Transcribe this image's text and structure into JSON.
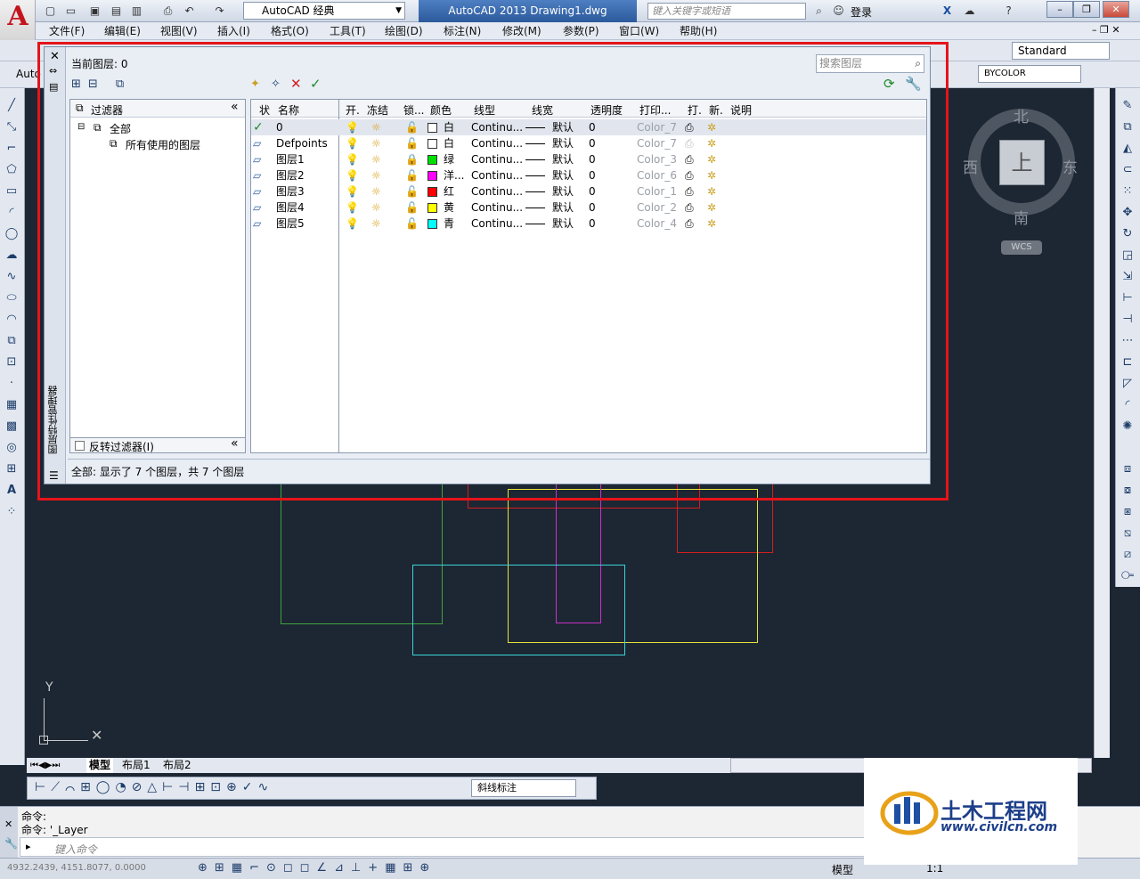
{
  "app": {
    "workspace": "AutoCAD 经典",
    "title": "AutoCAD 2013    Drawing1.dwg",
    "search_placeholder": "键入关键字或短语",
    "login": "登录",
    "logo_letter": "A"
  },
  "menu": [
    "文件(F)",
    "编辑(E)",
    "视图(V)",
    "插入(I)",
    "格式(O)",
    "工具(T)",
    "绘图(D)",
    "标注(N)",
    "修改(M)",
    "参数(P)",
    "窗口(W)",
    "帮助(H)"
  ],
  "toolbar": {
    "text_style": "Standard",
    "bycolor": "BYCOLOR",
    "auto": "Auto"
  },
  "dialog": {
    "current_layer": "当前图层: 0",
    "search_placeholder": "搜索图层",
    "filters_header": "过滤器",
    "tree": [
      "全部",
      "所有使用的图层"
    ],
    "invert_filter": "反转过滤器(I)",
    "side_title": "图层特性管理器",
    "status": "全部: 显示了 7 个图层，共 7 个图层",
    "columns": [
      "状",
      "名称",
      "开.",
      "冻结",
      "锁...",
      "颜色",
      "线型",
      "线宽",
      "透明度",
      "打印...",
      "打.",
      "新.",
      "说明"
    ],
    "layers": [
      {
        "name": "0",
        "color_name": "白",
        "color": "#ffffff",
        "linetype": "Continu...",
        "lineweight": "默认",
        "transparency": "0",
        "plot_style": "Color_7",
        "current": true
      },
      {
        "name": "Defpoints",
        "color_name": "白",
        "color": "#ffffff",
        "linetype": "Continu...",
        "lineweight": "默认",
        "transparency": "0",
        "plot_style": "Color_7",
        "current": false
      },
      {
        "name": "图层1",
        "color_name": "绿",
        "color": "#00e000",
        "linetype": "Continu...",
        "lineweight": "默认",
        "transparency": "0",
        "plot_style": "Color_3",
        "current": false
      },
      {
        "name": "图层2",
        "color_name": "洋...",
        "color": "#ff00ff",
        "linetype": "Continu...",
        "lineweight": "默认",
        "transparency": "0",
        "plot_style": "Color_6",
        "current": false
      },
      {
        "name": "图层3",
        "color_name": "红",
        "color": "#ff0000",
        "linetype": "Continu...",
        "lineweight": "默认",
        "transparency": "0",
        "plot_style": "Color_1",
        "current": false
      },
      {
        "name": "图层4",
        "color_name": "黄",
        "color": "#ffff00",
        "linetype": "Continu...",
        "lineweight": "默认",
        "transparency": "0",
        "plot_style": "Color_2",
        "current": false
      },
      {
        "name": "图层5",
        "color_name": "青",
        "color": "#00ffff",
        "linetype": "Continu...",
        "lineweight": "默认",
        "transparency": "0",
        "plot_style": "Color_4",
        "current": false
      }
    ]
  },
  "viewcube": {
    "north": "北",
    "south": "南",
    "east": "东",
    "west": "西",
    "top": "上",
    "wcs": "WCS"
  },
  "ucs": {
    "y": "Y"
  },
  "tabs": [
    "模型",
    "布局1",
    "布局2"
  ],
  "dimstyle": "斜线标注",
  "command": {
    "line1": "命令:",
    "line2": "命令: '_Layer",
    "placeholder": "键入命令"
  },
  "status": {
    "coords": "4932.2439, 4151.8077, 0.0000",
    "model": "模型",
    "scale": "1:1"
  },
  "watermark": {
    "name": "土木工程网",
    "url": "www.civilcn.com"
  }
}
